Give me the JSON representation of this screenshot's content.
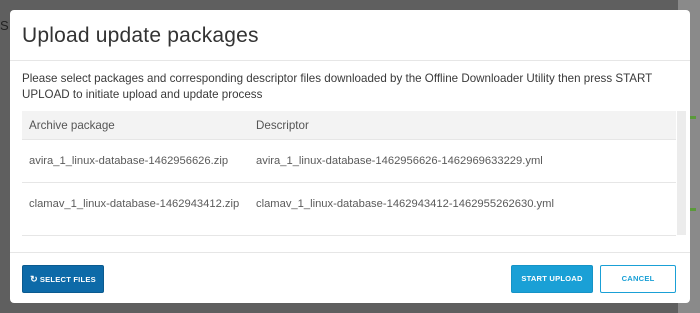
{
  "dialog": {
    "title": "Upload update packages",
    "description": "Please select packages and corresponding descriptor files downloaded by the Offline Downloader Utility then press START UPLOAD to initiate upload and update process"
  },
  "table": {
    "headers": [
      "Archive package",
      "Descriptor"
    ],
    "rows": [
      {
        "archive": "avira_1_linux-database-1462956626.zip",
        "descriptor": "avira_1_linux-database-1462956626-1462969633229.yml"
      },
      {
        "archive": "clamav_1_linux-database-1462943412.zip",
        "descriptor": "clamav_1_linux-database-1462943412-1462955262630.yml"
      }
    ]
  },
  "footer": {
    "select_files_label": "SELECT FILES",
    "select_files_icon": "refresh-icon",
    "start_upload_label": "START UPLOAD",
    "cancel_label": "CANCEL"
  },
  "colors": {
    "primary_dark": "#0d6aa8",
    "primary": "#1aa0d6",
    "overlay": "#5f5f5f"
  }
}
